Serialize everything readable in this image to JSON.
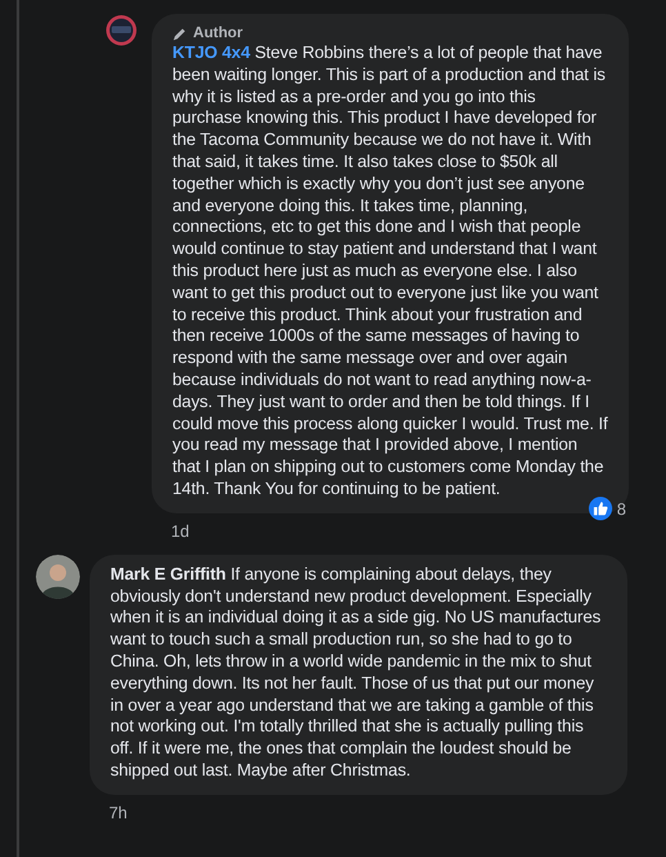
{
  "comments": [
    {
      "kind": "reply",
      "badge": "Author",
      "author": "KTJO 4x4",
      "text": "Steve Robbins there’s a lot of people that have been waiting longer. This is part of a production and that is why it is listed as a pre-order and you go into this purchase knowing this. This product I have developed for the Tacoma Community because we do not have it. With that said, it takes time. It also takes close to $50k all together which is exactly why you don’t just see anyone and everyone doing this. It takes time, planning, connections, etc to get this done and I wish that people would continue to stay patient and understand that I want this product here just as much as everyone else. I also want to get this product out to everyone just like you want to receive this product. Think about your frustration and then receive 1000s of the same messages of having to respond with the same message over and over again because individuals do not want to read anything now-a-days. They just want to order and then be told things. If I could move this process along quicker I would. Trust me. If you read my message that I provided above, I mention that I plan on shipping out to customers come Monday the 14th. Thank You for continuing to be patient.",
      "time": "1d",
      "reactions": "8"
    },
    {
      "kind": "comment",
      "author": "Mark E Griffith",
      "text": "If anyone is complaining about delays, they obviously don't understand new product development. Especially when it is an individual doing it as a side gig. No US manufactures want to touch such a small production run, so she had to go to China. Oh, lets throw in a world wide pandemic in the mix to shut everything down. Its not her fault. Those of us that put our money in over a year ago understand that we are taking a gamble of this not working out. I'm totally thrilled that she is actually pulling this off. If it were me, the ones that complain the loudest should be shipped out last. Maybe after Christmas.",
      "time": "7h"
    }
  ]
}
